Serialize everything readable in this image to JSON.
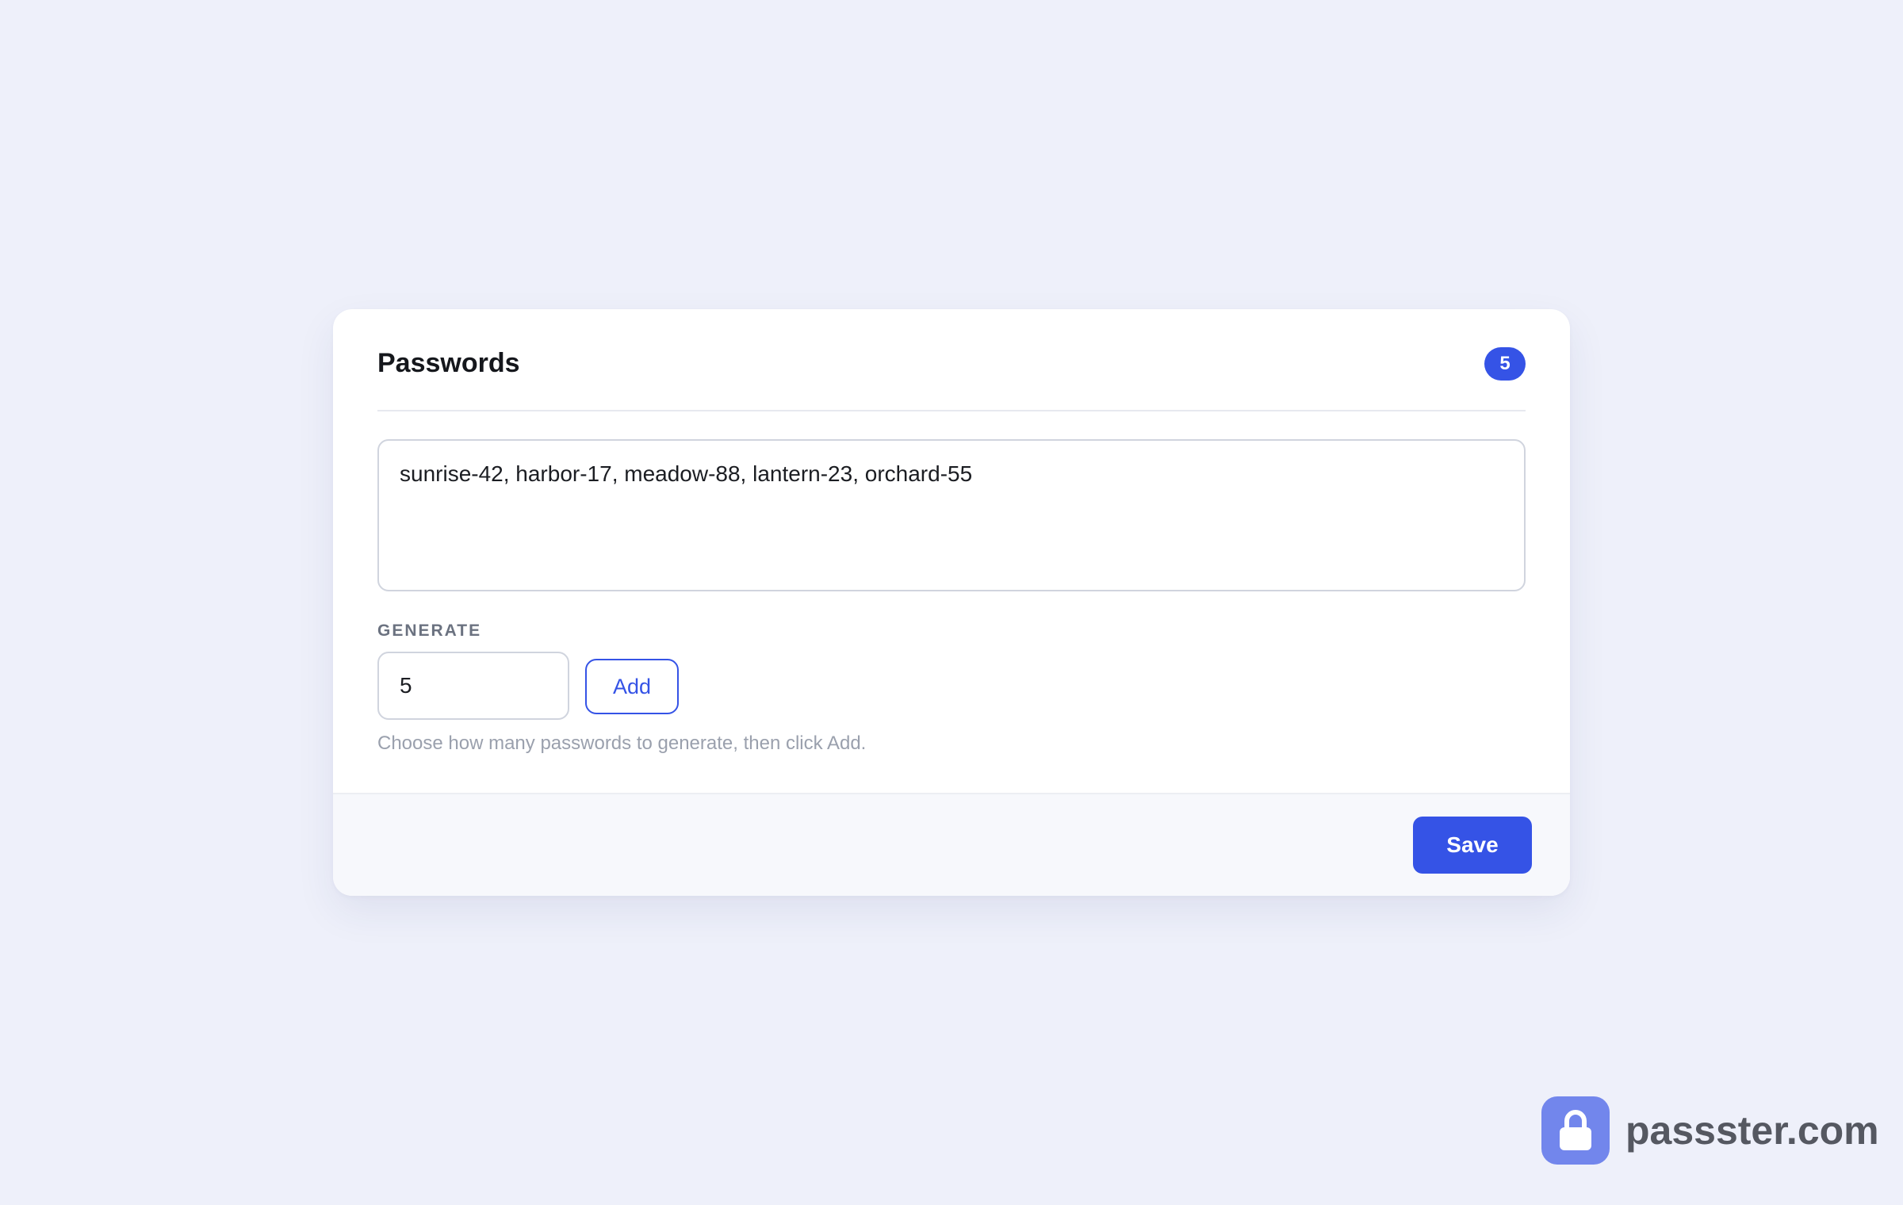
{
  "card": {
    "title": "Passwords",
    "count_badge": "5",
    "passwords_text": "sunrise-42, harbor-17, meadow-88, lantern-23, orchard-55",
    "generate": {
      "label": "GENERATE",
      "count_value": "5",
      "add_label": "Add",
      "hint": "Choose how many passwords to generate, then click Add."
    },
    "footer": {
      "save_label": "Save"
    }
  },
  "brand": {
    "icon": "lock-icon",
    "name": "passster.com"
  },
  "colors": {
    "accent": "#3553e6",
    "background": "#eef0fa",
    "brand_icon": "#7286ec"
  }
}
